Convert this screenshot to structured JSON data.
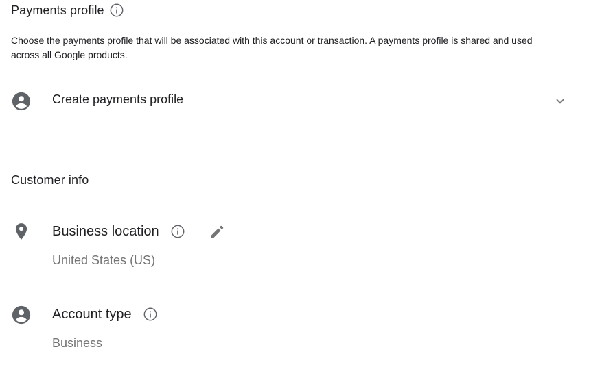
{
  "payments_profile": {
    "title": "Payments profile",
    "description": "Choose the payments profile that will be associated with this account or transaction. A payments profile is shared and used across all Google products.",
    "select_label": "Create payments profile"
  },
  "customer_info": {
    "title": "Customer info",
    "business_location": {
      "label": "Business location",
      "value": "United States (US)"
    },
    "account_type": {
      "label": "Account type",
      "value": "Business"
    }
  },
  "icons": {
    "info": "info-outline-icon",
    "account": "account-circle-icon",
    "location": "location-pin-icon",
    "edit": "pencil-icon",
    "chevron": "chevron-down-icon"
  },
  "colors": {
    "text_primary": "#202124",
    "text_secondary": "#757575",
    "icon_gray": "#5f6368",
    "divider": "#e0e0e0"
  }
}
